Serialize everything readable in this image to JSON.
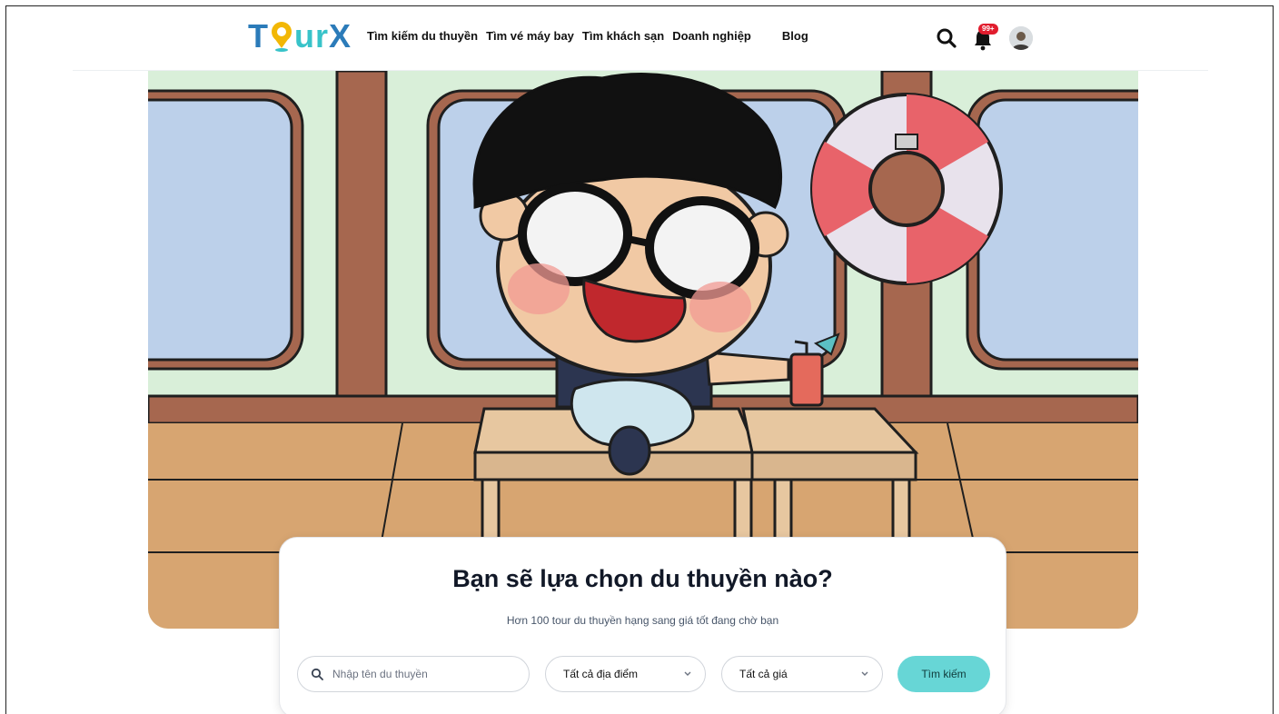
{
  "header": {
    "logo": {
      "part1": "T",
      "part2": "ur",
      "part3": "X"
    },
    "nav": [
      {
        "label": "Tìm kiếm du thuyền"
      },
      {
        "label": "Tìm vé máy bay"
      },
      {
        "label": "Tìm khách sạn"
      },
      {
        "label": "Doanh nghiệp"
      },
      {
        "label": "Blog"
      }
    ],
    "notification_badge": "99+",
    "icons": [
      "search-icon",
      "bell-icon",
      "avatar"
    ]
  },
  "hero": {
    "title": "Bạn sẽ lựa chọn du thuyền nào?",
    "subtitle": "Hơn 100 tour du thuyền hạng sang giá tốt đang chờ bạn"
  },
  "search": {
    "placeholder": "Nhập tên du thuyền",
    "location_select": "Tất cả địa điểm",
    "price_select": "Tất cả giá",
    "button_label": "Tìm kiếm"
  },
  "colors": {
    "logo_dark": "#2b7bb9",
    "logo_teal": "#38c3c9",
    "button": "#67d6d6",
    "badge": "#e11d2e",
    "wall": "#d9efd9",
    "wood": "#a6674f",
    "floor": "#d7a571"
  }
}
